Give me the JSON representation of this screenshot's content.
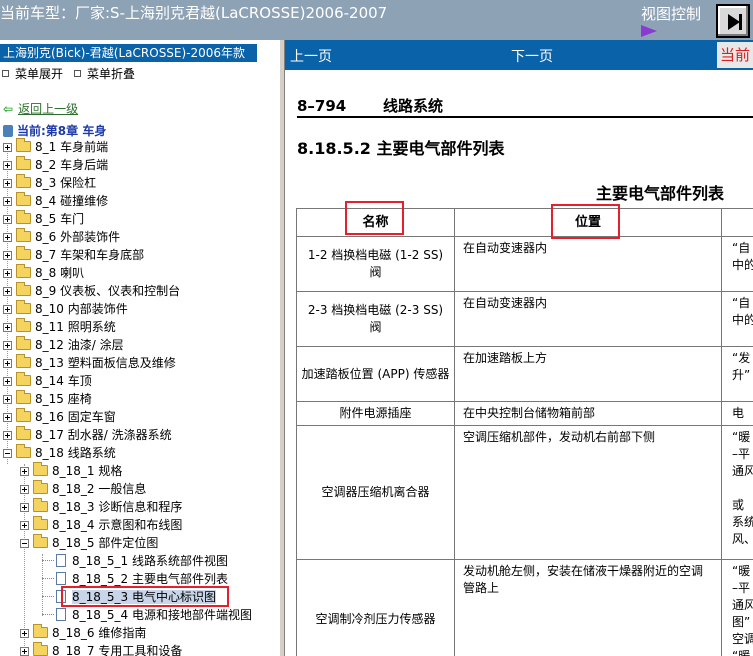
{
  "topbar": {
    "title": "当前车型：厂家:S-上海别克君越(LaCROSSE)2006-2007",
    "view_control": "视图控制"
  },
  "sidebar": {
    "car_header": "上海别克(Bick)-君越(LaCROSSE)-2006年款",
    "expand_all": "菜单展开",
    "collapse_all": "菜单折叠",
    "back": "返回上一级",
    "current": "当前:第8章  车身",
    "items": [
      "8_1 车身前端",
      "8_2 车身后端",
      "8_3 保险杠",
      "8_4 碰撞维修",
      "8_5 车门",
      "8_6 外部装饰件",
      "8_7 车架和车身底部",
      "8_8 喇叭",
      "8_9 仪表板、仪表和控制台",
      "8_10 内部装饰件",
      "8_11 照明系统",
      "8_12 油漆/ 涂层",
      "8_13 塑料面板信息及维修",
      "8_14 车顶",
      "8_15 座椅",
      "8_16 固定车窗",
      "8_17 刮水器/ 洗涤器系统",
      "8_18 线路系统"
    ],
    "subitems": [
      "8_18_1 规格",
      "8_18_2 一般信息",
      "8_18_3 诊断信息和程序",
      "8_18_4 示意图和布线图",
      "8_18_5 部件定位图"
    ],
    "leaves": [
      "8_18_5_1 线路系统部件视图",
      "8_18_5_2 主要电气部件列表",
      "8_18_5_3 电气中心标识图",
      "8_18_5_4 电源和接地部件端视图"
    ],
    "after": [
      "8_18_6 维修指南",
      "8_18_7 专用工具和设备"
    ]
  },
  "nav": {
    "prev": "上一页",
    "next": "下一页",
    "current": "当前"
  },
  "doc": {
    "page_no": "8–794",
    "chapter": "线路系统",
    "section_title": "8.18.5.2 主要电气部件列表",
    "table_title": "主要电气部件列表",
    "col_name": "名称",
    "col_location": "位置",
    "rows": [
      {
        "name": "1-2 档换档电磁 (1-2 SS) 阀",
        "location": "在自动变速器内",
        "desc": "“自\n中的"
      },
      {
        "name": "2-3 档换档电磁 (2-3 SS) 阀",
        "location": "在自动变速器内",
        "desc": "“自\n中的"
      },
      {
        "name": "加速踏板位置 (APP) 传感器",
        "location": "在加速踏板上方",
        "desc": "“发\n升”"
      },
      {
        "name": "附件电源插座",
        "location": "在中央控制台储物箱前部",
        "desc": "电"
      },
      {
        "name": "空调器压缩机离合器",
        "location": "空调压缩机部件，发动机右前部下侧",
        "desc": "“暖\n–平\n通风\n\n或\n系统\n风、"
      },
      {
        "name": "空调制冷剂压力传感器",
        "location": "发动机舱左侧，安装在储液干燥器附近的空调管路上",
        "desc": "“暖\n–平\n通风\n图”\n空调\n“暖"
      }
    ]
  }
}
